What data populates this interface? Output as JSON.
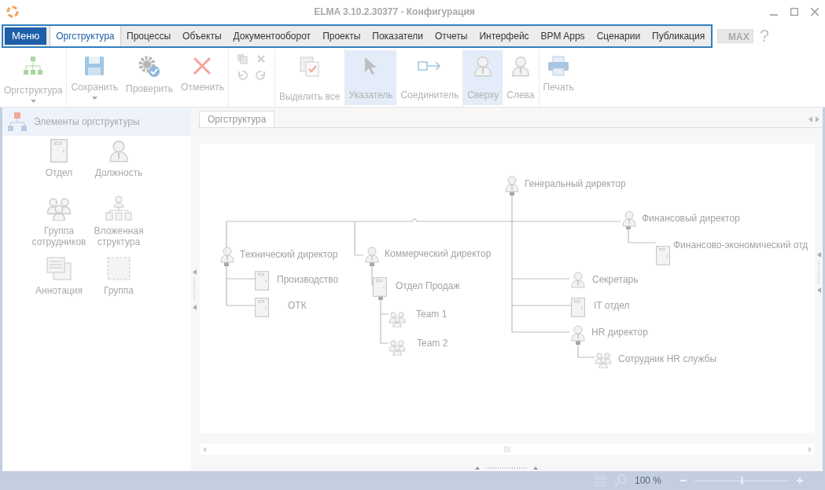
{
  "window": {
    "title": "ELMA 3.10.2.30377 - Конфигурация"
  },
  "menu_button": "Меню",
  "tabs": [
    {
      "label": "Оргструктура",
      "selected": true
    },
    {
      "label": "Процессы",
      "selected": false
    },
    {
      "label": "Объекты",
      "selected": false
    },
    {
      "label": "Документооборот",
      "selected": false
    },
    {
      "label": "Проекты",
      "selected": false
    },
    {
      "label": "Показатели",
      "selected": false
    },
    {
      "label": "Отчеты",
      "selected": false
    },
    {
      "label": "Интерфейс",
      "selected": false
    },
    {
      "label": "BPM Apps",
      "selected": false
    },
    {
      "label": "Сценарии",
      "selected": false
    },
    {
      "label": "Публикация",
      "selected": false
    }
  ],
  "max_button": "MAX",
  "help_button": "?",
  "toolbar": [
    {
      "kind": "orgchart",
      "label": "Оргструктура",
      "dropdown": true,
      "selected": false
    },
    {
      "kind": "save",
      "label": "Сохранить",
      "dropdown": true,
      "selected": false
    },
    {
      "kind": "check",
      "label": "Проверить",
      "dropdown": false,
      "selected": false
    },
    {
      "kind": "cancel",
      "label": "Отменить",
      "dropdown": false,
      "selected": false
    },
    {
      "kind": "small"
    },
    {
      "kind": "selectall",
      "label": "Выделить все",
      "dropdown": false,
      "selected": false
    },
    {
      "kind": "pointer",
      "label": "Указатель",
      "dropdown": false,
      "selected": true
    },
    {
      "kind": "connector",
      "label": "Соединитель",
      "dropdown": false,
      "selected": false
    },
    {
      "kind": "top",
      "label": "Сверху",
      "dropdown": false,
      "selected": true
    },
    {
      "kind": "left",
      "label": "Слева",
      "dropdown": false,
      "selected": false
    },
    {
      "kind": "print",
      "label": "Печать",
      "dropdown": false,
      "selected": false
    }
  ],
  "sidebar": {
    "title": "Элементы оргструктуры",
    "items": [
      {
        "kind": "department",
        "label": "Отдел"
      },
      {
        "kind": "person",
        "label": "Должность"
      },
      {
        "kind": "group",
        "label": "Группа сотрудников"
      },
      {
        "kind": "nested",
        "label": "Вложенная структура"
      },
      {
        "kind": "note",
        "label": "Аннотация"
      },
      {
        "kind": "frame",
        "label": "Группа"
      }
    ]
  },
  "document_tab": {
    "label": "Оргструктура",
    "selected": true
  },
  "diagram": {
    "nodes": [
      {
        "kind": "person",
        "label": "Генеральный директор"
      },
      {
        "kind": "person",
        "label": "Финансовый директор"
      },
      {
        "kind": "department",
        "label": "Финансово-экономический отд"
      },
      {
        "kind": "person",
        "label": "Технический директор"
      },
      {
        "kind": "department",
        "label": "Производство"
      },
      {
        "kind": "department",
        "label": "ОТК"
      },
      {
        "kind": "person",
        "label": "Коммерческий директор"
      },
      {
        "kind": "department",
        "label": "Отдел Продаж"
      },
      {
        "kind": "group",
        "label": "Team 1"
      },
      {
        "kind": "group",
        "label": "Team 2"
      },
      {
        "kind": "person",
        "label": "Секретарь"
      },
      {
        "kind": "department",
        "label": "IT отдел"
      },
      {
        "kind": "person",
        "label": "HR директор"
      },
      {
        "kind": "group",
        "label": "Сотрудник HR службы"
      }
    ]
  },
  "status_bar": {
    "zoom": "100 %",
    "zoom_slider": {
      "level": 0.5
    }
  }
}
